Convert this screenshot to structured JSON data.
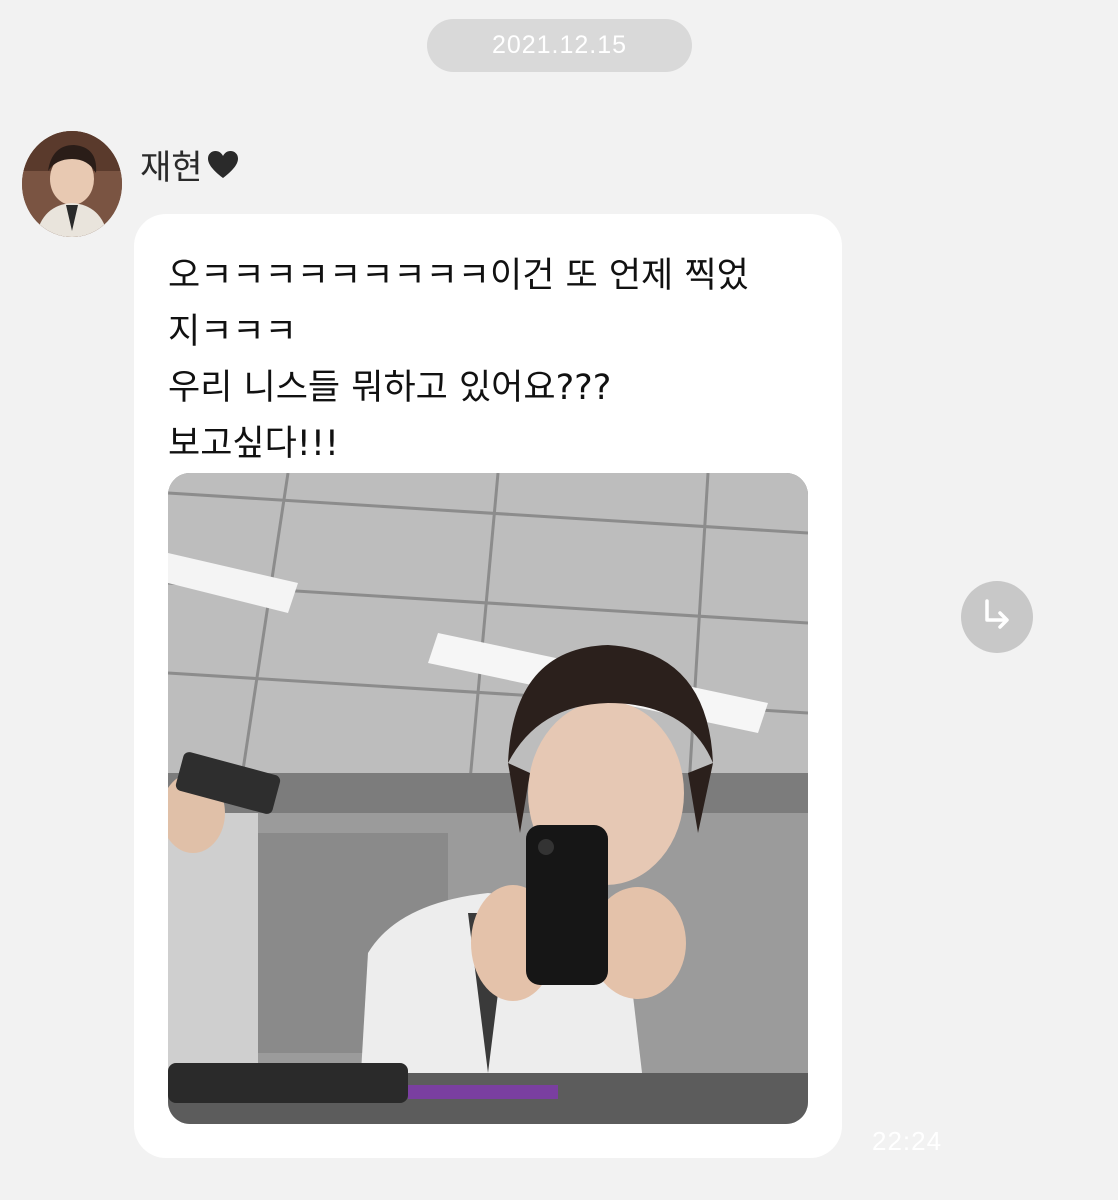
{
  "date_divider": {
    "label": "2021.12.15"
  },
  "sender": {
    "name": "재현",
    "badge_icon": "heart-icon",
    "badge_color": "#2a2a2a"
  },
  "message": {
    "lines": [
      "오ㅋㅋㅋㅋㅋㅋㅋㅋㅋ이건 또 언제 찍었",
      "지ㅋㅋㅋ",
      "우리 니스들 뭐하고 있어요???",
      "보고싶다!!!"
    ],
    "time": "22:24"
  },
  "forward_button": {
    "icon": "forward-arrow-icon"
  },
  "colors": {
    "background": "#f2f2f2",
    "bubble": "#ffffff",
    "date_pill": "#d9d9d9",
    "forward_button": "#c8c8c8"
  }
}
